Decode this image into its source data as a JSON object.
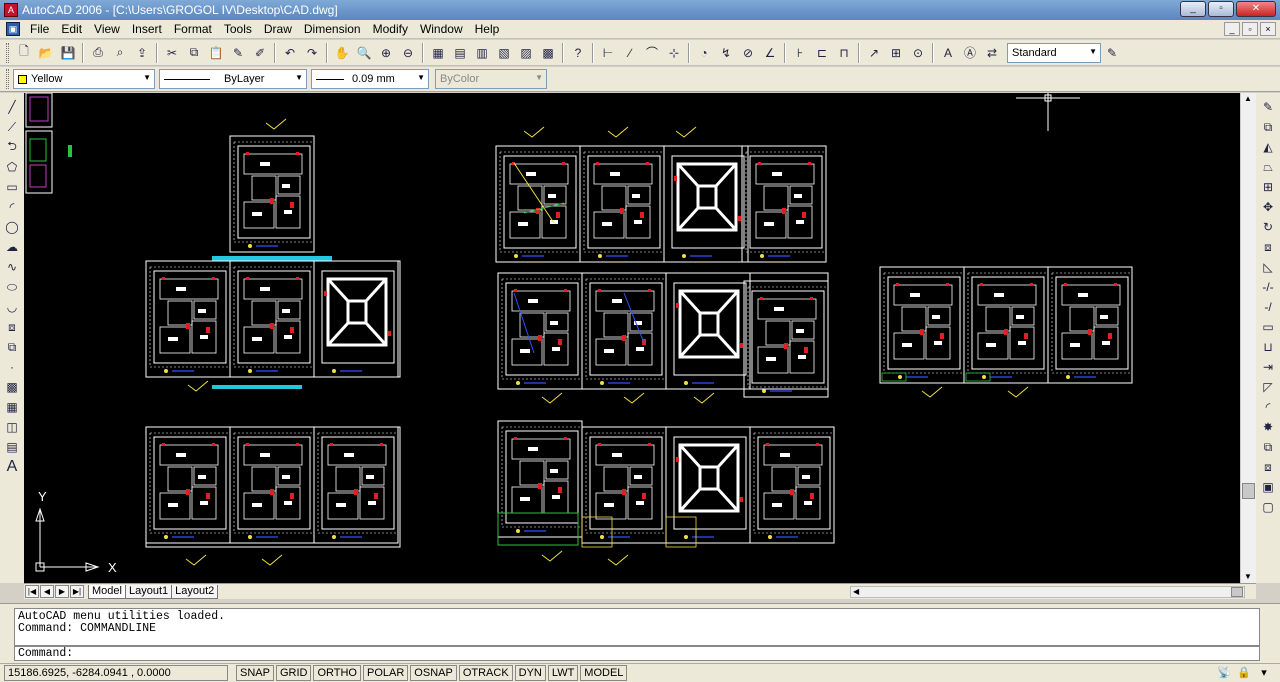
{
  "window": {
    "title": "AutoCAD 2006 - [C:\\Users\\GROGOL IV\\Desktop\\CAD.dwg]",
    "minimize": "_",
    "maximize": "▫",
    "close": "✕"
  },
  "menubar": {
    "items": [
      "File",
      "Edit",
      "View",
      "Insert",
      "Format",
      "Tools",
      "Draw",
      "Dimension",
      "Modify",
      "Window",
      "Help"
    ],
    "mdi_minimize": "_",
    "mdi_restore": "▫",
    "mdi_close": "×"
  },
  "toolbar": {
    "text_style": "Standard"
  },
  "properties": {
    "layer_color": "Yellow",
    "layer_color_hex": "#ffff00",
    "linetype": "ByLayer",
    "lineweight": "0.09 mm",
    "plot_style": "ByColor"
  },
  "layout_tabs": [
    "Model",
    "Layout1",
    "Layout2"
  ],
  "command": {
    "history_line1": "AutoCAD menu utilities loaded.",
    "history_line2": "Command: COMMANDLINE",
    "prompt": "Command:"
  },
  "status": {
    "coordinates": "15186.6925, -6284.0941 , 0.0000",
    "toggles": [
      "SNAP",
      "GRID",
      "ORTHO",
      "POLAR",
      "OSNAP",
      "OTRACK",
      "DYN",
      "LWT",
      "MODEL"
    ]
  },
  "ucs": {
    "x_label": "X",
    "y_label": "Y"
  },
  "colors": {
    "canvas": "#000000",
    "sheet_border": "#ffffff",
    "accent_cyan": "#22c8e0",
    "accent_yellow": "#f0e040",
    "accent_red": "#e02020",
    "accent_blue": "#3050ff",
    "accent_green": "#30c040"
  }
}
